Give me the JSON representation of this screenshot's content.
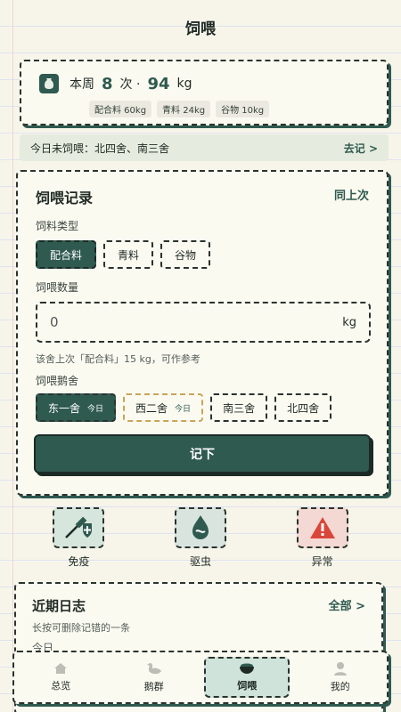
{
  "header": {
    "title": "饲喂"
  },
  "weekly": {
    "label": "本周",
    "count": "8",
    "count_unit": "次 ·",
    "weight": "94",
    "weight_unit": "kg",
    "chips": [
      "配合料 60kg",
      "青料 24kg",
      "谷物 10kg"
    ]
  },
  "notice": {
    "text": "今日未饲喂：北四舍、南三舍",
    "action": "去记 >"
  },
  "record": {
    "title": "饲喂记录",
    "same_as_last": "同上次",
    "feed_type_label": "饲料类型",
    "feed_types": [
      "配合料",
      "青料",
      "谷物"
    ],
    "quantity_label": "饲喂数量",
    "quantity_value": "0",
    "quantity_unit": "kg",
    "hint": "该舍上次「配合料」15 kg，可作参考",
    "pen_label": "饲喂鹅舍",
    "pens": [
      {
        "name": "东一舍",
        "tag": "今日"
      },
      {
        "name": "西二舍",
        "tag": "今日"
      },
      {
        "name": "南三舍",
        "tag": ""
      },
      {
        "name": "北四舍",
        "tag": ""
      }
    ],
    "submit": "记下"
  },
  "quick": {
    "vaccine": "免疫",
    "deworm": "驱虫",
    "abnormal": "异常"
  },
  "log": {
    "title": "近期日志",
    "all": "全部 >",
    "subtitle": "长按可删除记错的一条",
    "day": "今日"
  },
  "tabs": {
    "overview": "总览",
    "flock": "鹅群",
    "feeding": "饲喂",
    "mine": "我的"
  },
  "colors": {
    "accent": "#2f5a50",
    "paper": "#f7f5ea"
  }
}
